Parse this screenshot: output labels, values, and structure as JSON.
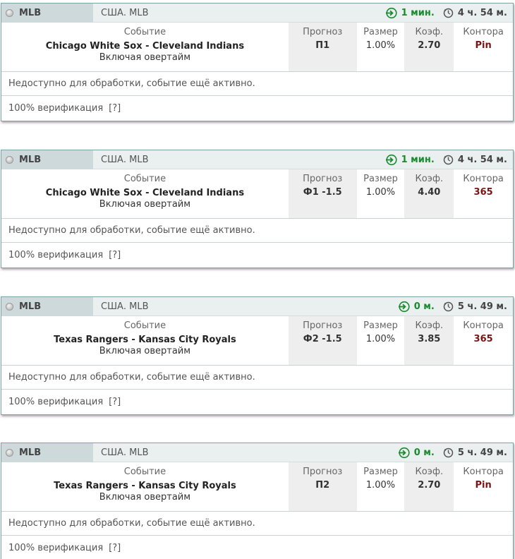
{
  "colors": {
    "time_since": "#1a8a2e",
    "bookmaker": "#7a1414",
    "card_border": "#7fa3a6",
    "header_bg": "#eaf0f0",
    "sport_bg": "#cdd9db"
  },
  "labels": {
    "event": "Событие",
    "prediction": "Прогноз",
    "size": "Размер",
    "coef": "Коэф.",
    "bookmaker": "Контора"
  },
  "cards": [
    {
      "sport": "MLB",
      "league": "США. MLB",
      "time_since": "1 мин.",
      "time_left": "4 ч. 54 м.",
      "event_name": "Chicago White Sox - Cleveland Indians",
      "event_note": "Включая овертайм",
      "prediction": "П1",
      "size": "1.00%",
      "coef": "2.70",
      "bookmaker": "Pin",
      "status": "Недоступно для обработки, событие ещё активно.",
      "verification": "100% верификация",
      "verification_link": "[?]"
    },
    {
      "sport": "MLB",
      "league": "США. MLB",
      "time_since": "1 мин.",
      "time_left": "4 ч. 54 м.",
      "event_name": "Chicago White Sox - Cleveland Indians",
      "event_note": "Включая овертайм",
      "prediction": "Ф1 -1.5",
      "size": "1.00%",
      "coef": "4.40",
      "bookmaker": "365",
      "status": "Недоступно для обработки, событие ещё активно.",
      "verification": "100% верификация",
      "verification_link": "[?]"
    },
    {
      "sport": "MLB",
      "league": "США. MLB",
      "time_since": "0 м.",
      "time_left": "5 ч. 49 м.",
      "event_name": "Texas Rangers - Kansas City Royals",
      "event_note": "Включая овертайм",
      "prediction": "Ф2 -1.5",
      "size": "1.00%",
      "coef": "3.85",
      "bookmaker": "365",
      "status": "Недоступно для обработки, событие ещё активно.",
      "verification": "100% верификация",
      "verification_link": "[?]"
    },
    {
      "sport": "MLB",
      "league": "США. MLB",
      "time_since": "0 м.",
      "time_left": "5 ч. 49 м.",
      "event_name": "Texas Rangers - Kansas City Royals",
      "event_note": "Включая овертайм",
      "prediction": "П2",
      "size": "1.00%",
      "coef": "2.70",
      "bookmaker": "Pin",
      "status": "Недоступно для обработки, событие ещё активно.",
      "verification": "100% верификация",
      "verification_link": "[?]"
    }
  ]
}
